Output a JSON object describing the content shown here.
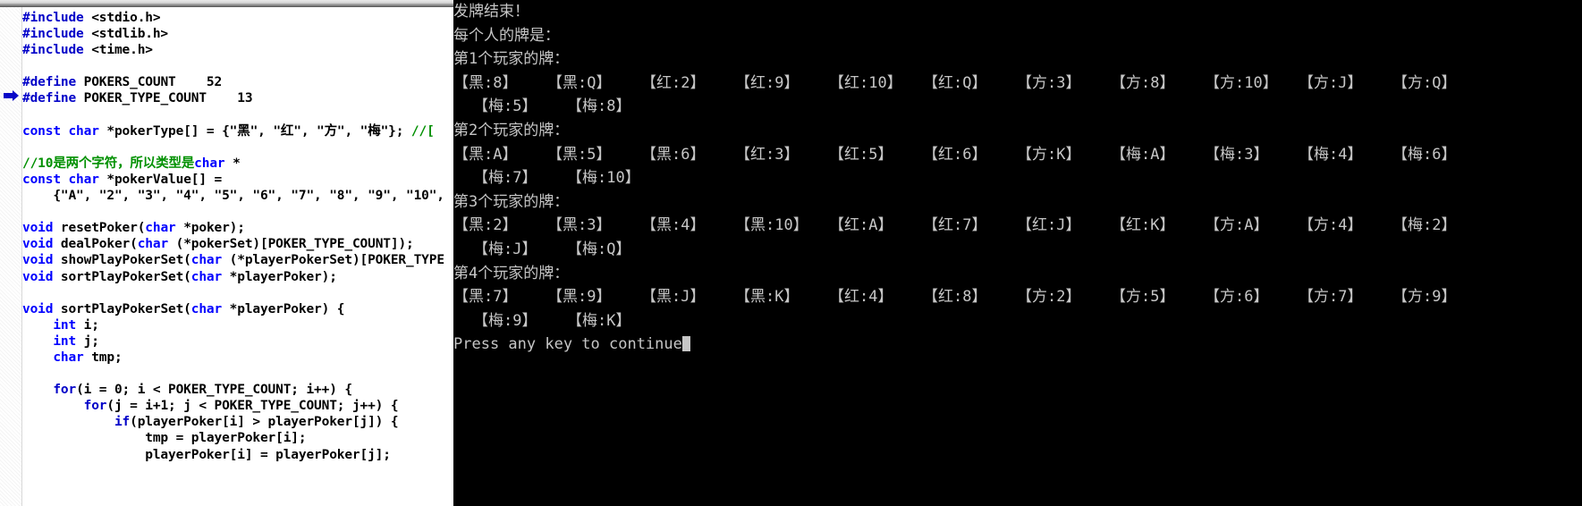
{
  "editor": {
    "gutter_marker_icon": "execution-arrow-icon",
    "code_lines": [
      [
        {
          "t": "#include ",
          "c": "pp"
        },
        {
          "t": "<stdio.h>",
          "c": "pl"
        }
      ],
      [
        {
          "t": "#include ",
          "c": "pp"
        },
        {
          "t": "<stdlib.h>",
          "c": "pl"
        }
      ],
      [
        {
          "t": "#include ",
          "c": "pp"
        },
        {
          "t": "<time.h>",
          "c": "pl"
        }
      ],
      [],
      [
        {
          "t": "#define ",
          "c": "pp"
        },
        {
          "t": "POKERS_COUNT    52",
          "c": "pl"
        }
      ],
      [
        {
          "t": "#define ",
          "c": "pp"
        },
        {
          "t": "POKER_TYPE_COUNT    13",
          "c": "pl"
        }
      ],
      [],
      [
        {
          "t": "const char ",
          "c": "kw"
        },
        {
          "t": "*pokerType[] = {\"黑\", \"红\", \"方\", \"梅\"}; ",
          "c": "pl"
        },
        {
          "t": "//[",
          "c": "cm"
        }
      ],
      [],
      [
        {
          "t": "//10是两个字符，所以类型是",
          "c": "cm"
        },
        {
          "t": "char ",
          "c": "kw"
        },
        {
          "t": "*",
          "c": "pl"
        }
      ],
      [
        {
          "t": "const char ",
          "c": "kw"
        },
        {
          "t": "*pokerValue[] = ",
          "c": "pl"
        }
      ],
      [
        {
          "t": "    {\"A\", \"2\", \"3\", \"4\", \"5\", \"6\", \"7\", \"8\", \"9\", \"10\",",
          "c": "pl"
        }
      ],
      [],
      [
        {
          "t": "void ",
          "c": "kw"
        },
        {
          "t": "resetPoker(",
          "c": "pl"
        },
        {
          "t": "char ",
          "c": "kw"
        },
        {
          "t": "*poker);",
          "c": "pl"
        }
      ],
      [
        {
          "t": "void ",
          "c": "kw"
        },
        {
          "t": "dealPoker(",
          "c": "pl"
        },
        {
          "t": "char ",
          "c": "kw"
        },
        {
          "t": "(*pokerSet)[POKER_TYPE_COUNT]);",
          "c": "pl"
        }
      ],
      [
        {
          "t": "void ",
          "c": "kw"
        },
        {
          "t": "showPlayPokerSet(",
          "c": "pl"
        },
        {
          "t": "char ",
          "c": "kw"
        },
        {
          "t": "(*playerPokerSet)[POKER_TYPE",
          "c": "pl"
        }
      ],
      [
        {
          "t": "void ",
          "c": "kw"
        },
        {
          "t": "sortPlayPokerSet(",
          "c": "pl"
        },
        {
          "t": "char ",
          "c": "kw"
        },
        {
          "t": "*playerPoker);",
          "c": "pl"
        }
      ],
      [],
      [
        {
          "t": "void ",
          "c": "kw"
        },
        {
          "t": "sortPlayPokerSet(",
          "c": "pl"
        },
        {
          "t": "char ",
          "c": "kw"
        },
        {
          "t": "*playerPoker) {",
          "c": "pl"
        }
      ],
      [
        {
          "t": "    int ",
          "c": "kw"
        },
        {
          "t": "i;",
          "c": "pl"
        }
      ],
      [
        {
          "t": "    int ",
          "c": "kw"
        },
        {
          "t": "j;",
          "c": "pl"
        }
      ],
      [
        {
          "t": "    char ",
          "c": "kw"
        },
        {
          "t": "tmp;",
          "c": "pl"
        }
      ],
      [],
      [
        {
          "t": "    for",
          "c": "pp"
        },
        {
          "t": "(i = 0; i < POKER_TYPE_COUNT; i++) {",
          "c": "pl"
        }
      ],
      [
        {
          "t": "        for",
          "c": "pp"
        },
        {
          "t": "(j = i+1; j < POKER_TYPE_COUNT; j++) {",
          "c": "pl"
        }
      ],
      [
        {
          "t": "            if",
          "c": "pp"
        },
        {
          "t": "(playerPoker[i] > playerPoker[j]) {",
          "c": "pl"
        }
      ],
      [
        {
          "t": "                tmp = playerPoker[i];",
          "c": "pl"
        }
      ],
      [
        {
          "t": "                playerPoker[i] = playerPoker[j];",
          "c": "pl"
        }
      ]
    ]
  },
  "console": {
    "header_lines": [
      "发牌结束！",
      "每个人的牌是："
    ],
    "players": [
      {
        "title": "第1个玩家的牌：",
        "row1": [
          "【黑:8】",
          "【黑:Q】",
          "【红:2】",
          "【红:9】",
          "【红:10】",
          "【红:Q】",
          "【方:3】",
          "【方:8】",
          "【方:10】",
          "【方:J】",
          "【方:Q】"
        ],
        "row2": [
          "【梅:5】",
          "【梅:8】"
        ]
      },
      {
        "title": "第2个玩家的牌：",
        "row1": [
          "【黑:A】",
          "【黑:5】",
          "【黑:6】",
          "【红:3】",
          "【红:5】",
          "【红:6】",
          "【方:K】",
          "【梅:A】",
          "【梅:3】",
          "【梅:4】",
          "【梅:6】"
        ],
        "row2": [
          "【梅:7】",
          "【梅:10】"
        ]
      },
      {
        "title": "第3个玩家的牌：",
        "row1": [
          "【黑:2】",
          "【黑:3】",
          "【黑:4】",
          "【黑:10】",
          "【红:A】",
          "【红:7】",
          "【红:J】",
          "【红:K】",
          "【方:A】",
          "【方:4】",
          "【梅:2】"
        ],
        "row2": [
          "【梅:J】",
          "【梅:Q】"
        ]
      },
      {
        "title": "第4个玩家的牌：",
        "row1": [
          "【黑:7】",
          "【黑:9】",
          "【黑:J】",
          "【黑:K】",
          "【红:4】",
          "【红:8】",
          "【方:2】",
          "【方:5】",
          "【方:6】",
          "【方:7】",
          "【方:9】"
        ],
        "row2": [
          "【梅:9】",
          "【梅:K】"
        ]
      }
    ],
    "prompt": "Press any key to continue",
    "cursor_icon": "block-cursor"
  },
  "colors": {
    "console_bg": "#000000",
    "console_fg": "#c6c6c6",
    "editor_bg": "#ffffff",
    "keyword": "#0000ff",
    "preprocessor": "#0000c8",
    "comment": "#009000",
    "marker": "#0808c8"
  }
}
